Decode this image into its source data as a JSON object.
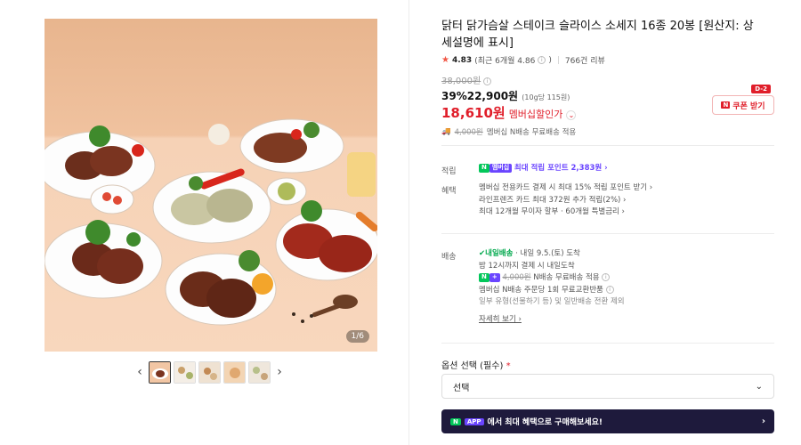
{
  "gallery": {
    "counter": "1/6",
    "prev_arrow": "‹",
    "next_arrow": "›",
    "thumb_count": 5
  },
  "product": {
    "title": "닭터 닭가슴살 스테이크 슬라이스 소세지 16종 20봉 [원산지: 상세설명에 표시]",
    "rating": {
      "star": "★",
      "score": "4.83",
      "recent": "(최근 6개월 4.86",
      "recent_close": ")",
      "reviews": "766건 리뷰"
    },
    "original_price": "38,000원",
    "discount_rate": "39%",
    "sale_price": "22,900원",
    "unit_price": "(10g당 115원)",
    "member_price": "18,610원",
    "member_price_label": "멤버십할인가",
    "coupon": {
      "dday": "D-2",
      "badge": "N",
      "label": "쿠폰 받기"
    },
    "shipping_note": {
      "strike": "4,000원",
      "text": "멤버십 N배송 무료배송 적용"
    }
  },
  "benefits": {
    "point_label": "적립",
    "point_badge_n": "N",
    "point_badge_mem": "멤버십",
    "point_text": "최대 적립 포인트 2,383원 ›",
    "perk_label": "혜택",
    "perks": [
      "멤버십 전용카드 결제 시 최대 15% 적립 포인트 받기 ›",
      "라인프렌즈 카드 최대 372원 추가 적립(2%) ›",
      "최대 12개월 무이자 할부 · 60개월 특별금리 ›"
    ]
  },
  "delivery": {
    "label": "배송",
    "badge": "✔내일배송",
    "arrival": "· 내일 9.5.(토) 도착",
    "cutoff": "밤 12시까지 결제 시 내일도착",
    "free_strike": "4,000원",
    "free_text": "N배송 무료배송 적용",
    "return_text": "멤버십 N배송 주문당 1회 무료교환반품",
    "exclude_text": "일부 유형(선물하기 등) 및 일반배송 전환 제외",
    "detail_link": "자세히 보기 ›"
  },
  "options": {
    "label": "옵션 선택 (필수)",
    "required_mark": "*",
    "select_value": "선택",
    "chevron": "⌄"
  },
  "banner": {
    "n": "N",
    "app": "APP",
    "text": "에서 최대 혜택으로 구매해보세요!",
    "arrow": "›"
  },
  "colors": {
    "accent_red": "#e01e2a",
    "naver_green": "#03c75a",
    "membership_purple": "#6a45ff",
    "banner_bg": "#1e1a3c"
  }
}
